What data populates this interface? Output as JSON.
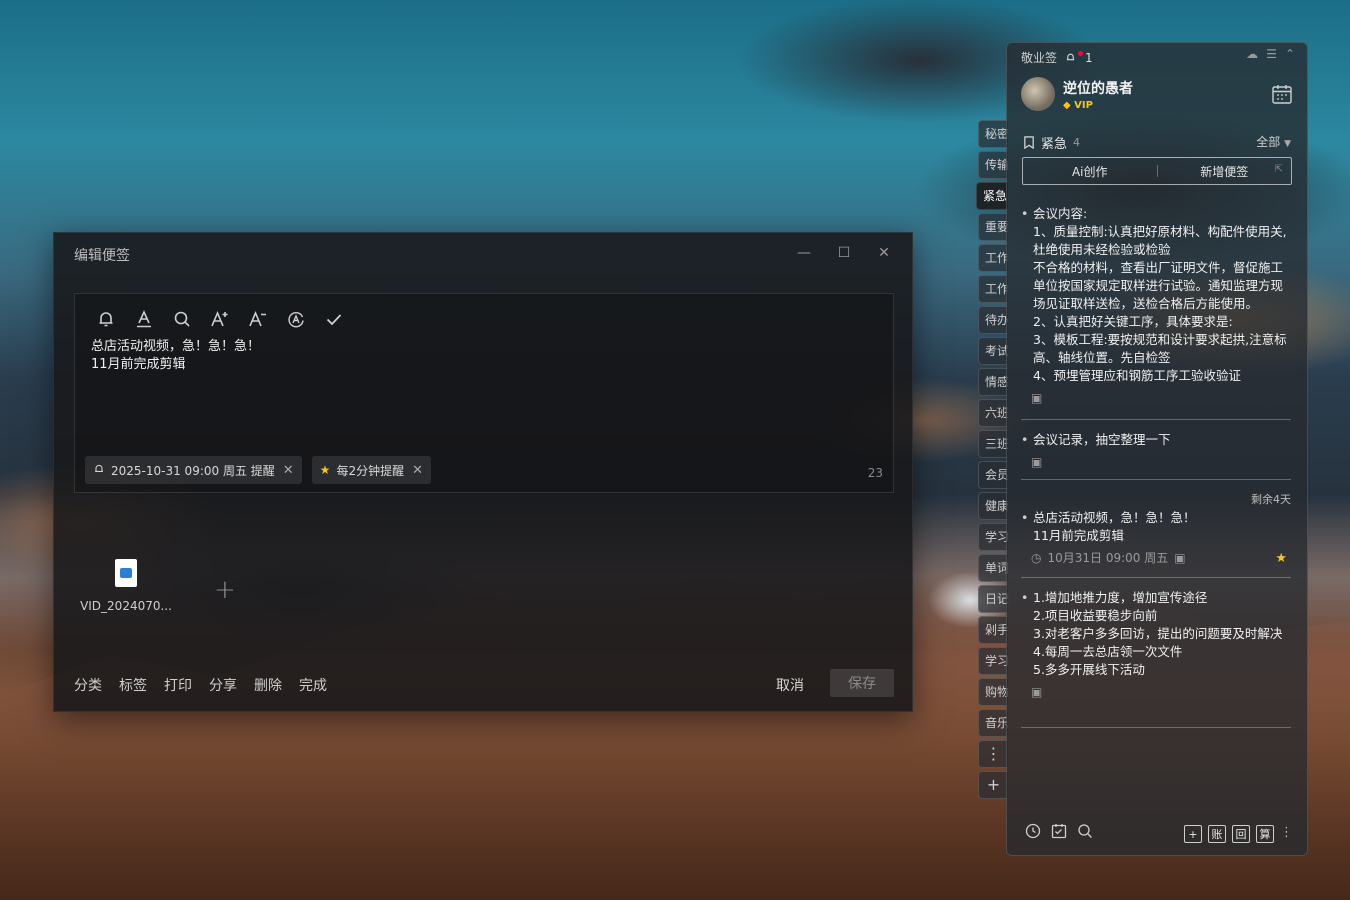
{
  "edit_window": {
    "title": "编辑便签",
    "content": "总店活动视频，急！急！急！\n11月前完成剪辑",
    "reminder_chip": "2025-10-31 09:00 周五 提醒",
    "repeat_chip": "每2分钟提醒",
    "char_count": "23",
    "attachment_name": "VID_2024070...",
    "bottom_actions": [
      "分类",
      "标签",
      "打印",
      "分享",
      "删除",
      "完成"
    ],
    "cancel_label": "取消",
    "save_label": "保存"
  },
  "categories": [
    "秘密",
    "传输",
    "紧急",
    "重要",
    "工作",
    "工作",
    "待办",
    "考试",
    "情感",
    "六班",
    "三班",
    "会员",
    "健康",
    "学习",
    "单词",
    "日记",
    "剁手",
    "学习",
    "购物",
    "音乐"
  ],
  "active_category_index": 2,
  "panel": {
    "app_name": "敬业签",
    "notification_count": "1",
    "username": "逆位的愚者",
    "vip_label": "VIP",
    "list_name": "紧急",
    "list_count": "4",
    "filter_label": "全部",
    "ai_create_label": "Ai创作",
    "new_note_label": "新增便签",
    "notes": [
      {
        "text": "会议内容:\n1、质量控制:认真把好原材料、构配件使用关,杜绝使用未经检验或检验\n不合格的材料，查看出厂证明文件，督促施工单位按国家规定取样进行试验。通知监理方现场见证取样送检，送检合格后方能使用。\n2、认真把好关键工序，具体要求是:\n3、模板工程:要按规范和设计要求起拱,注意标高、轴线位置。先自检签\n4、预埋管理应和钢筋工序工验收验证"
      },
      {
        "text": "会议记录，抽空整理一下"
      },
      {
        "text": "总店活动视频，急！急！急！\n11月前完成剪辑",
        "remaining": "剩余4天",
        "time": "10月31日 09:00 周五"
      },
      {
        "text": "1.增加地推力度，增加宣传途径\n2.项目收益要稳步向前\n3.对老客户多多回访，提出的问题要及时解决\n4.每周一去总店领一次文件\n5.多多开展线下活动"
      }
    ],
    "footer_buttons": [
      "+",
      "账",
      "回",
      "算"
    ]
  }
}
